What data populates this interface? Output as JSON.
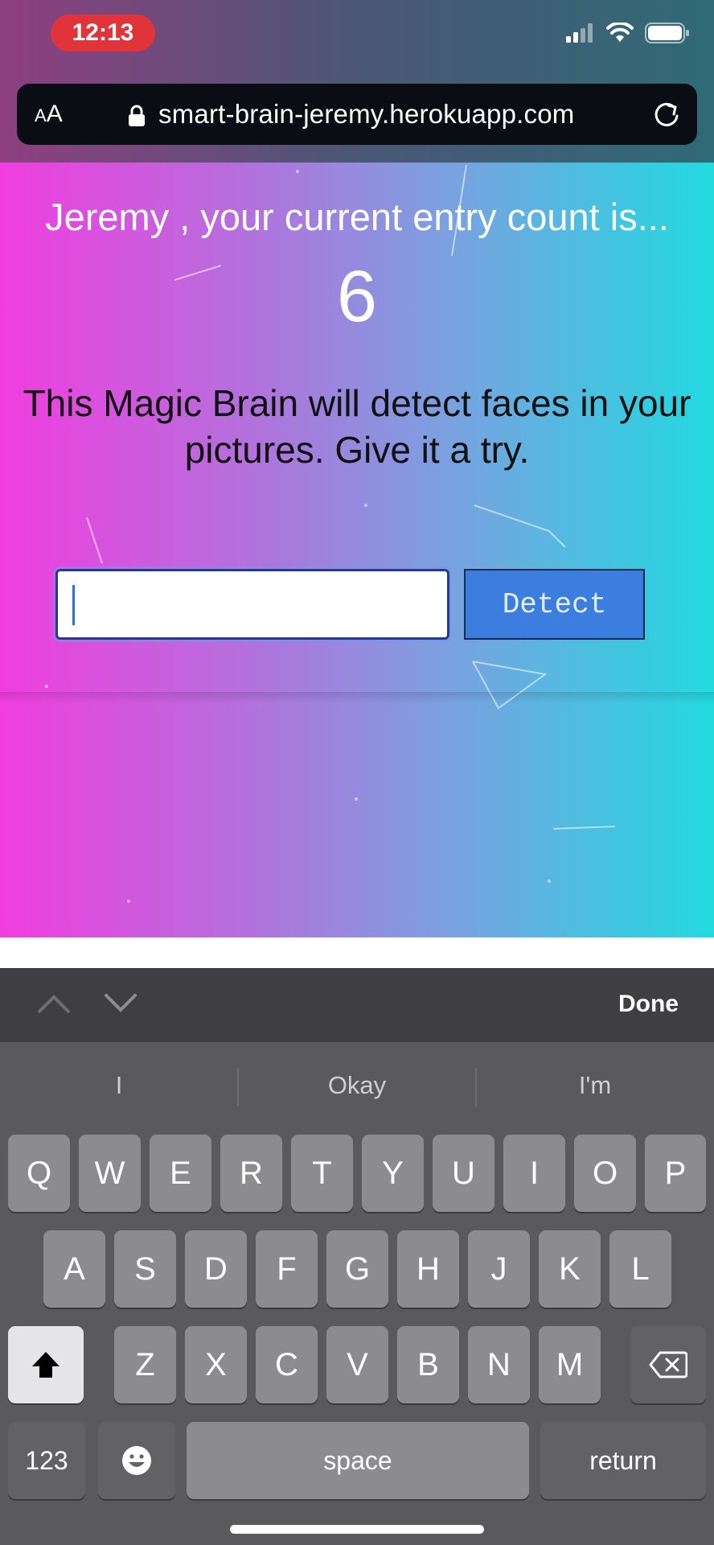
{
  "status_bar": {
    "time": "12:13"
  },
  "browser": {
    "aa_label_big": "A",
    "aa_label_small": "A",
    "url": "smart-brain-jeremy.herokuapp.com"
  },
  "app": {
    "entry_line": "Jeremy , your current entry count is...",
    "entry_count": "6",
    "description": "This Magic Brain will detect faces in your pictures. Give it a try.",
    "input": {
      "value": "",
      "placeholder": ""
    },
    "detect_label": "Detect"
  },
  "keyboard_toolbar": {
    "done_label": "Done"
  },
  "keyboard": {
    "suggestions": [
      "I",
      "Okay",
      "I'm"
    ],
    "row1": [
      "Q",
      "W",
      "E",
      "R",
      "T",
      "Y",
      "U",
      "I",
      "O",
      "P"
    ],
    "row2": [
      "A",
      "S",
      "D",
      "F",
      "G",
      "H",
      "J",
      "K",
      "L"
    ],
    "row3": [
      "Z",
      "X",
      "C",
      "V",
      "B",
      "N",
      "M"
    ],
    "numbers_label": "123",
    "space_label": "space",
    "return_label": "return"
  },
  "colors": {
    "gradient_left": "#f13ddf",
    "gradient_right": "#22d9e0",
    "detect_button": "#3b7ee0",
    "time_pill": "#e0343a"
  },
  "icons": [
    "signal-icon",
    "wifi-icon",
    "battery-icon",
    "lock-icon",
    "reload-icon",
    "chevron-up-icon",
    "chevron-down-icon",
    "shift-icon",
    "emoji-icon",
    "delete-icon"
  ]
}
